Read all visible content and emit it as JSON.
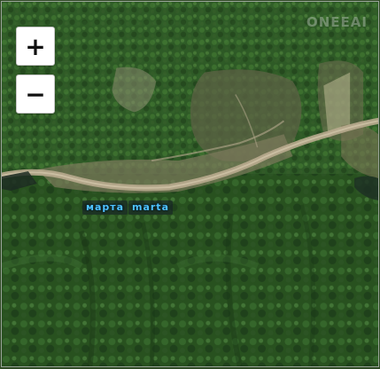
{
  "map": {
    "zoom_in_label": "+",
    "zoom_out_label": "−",
    "watermark_text": "ONEEAI",
    "place_labels": [
      "марта",
      "marta"
    ]
  },
  "colors": {
    "forest_dark": "#23451d",
    "forest_mid": "#3a6b2f",
    "clearing": "#6a6a4e",
    "road": "#b9ab8f",
    "label_text": "#4fc3ff"
  }
}
